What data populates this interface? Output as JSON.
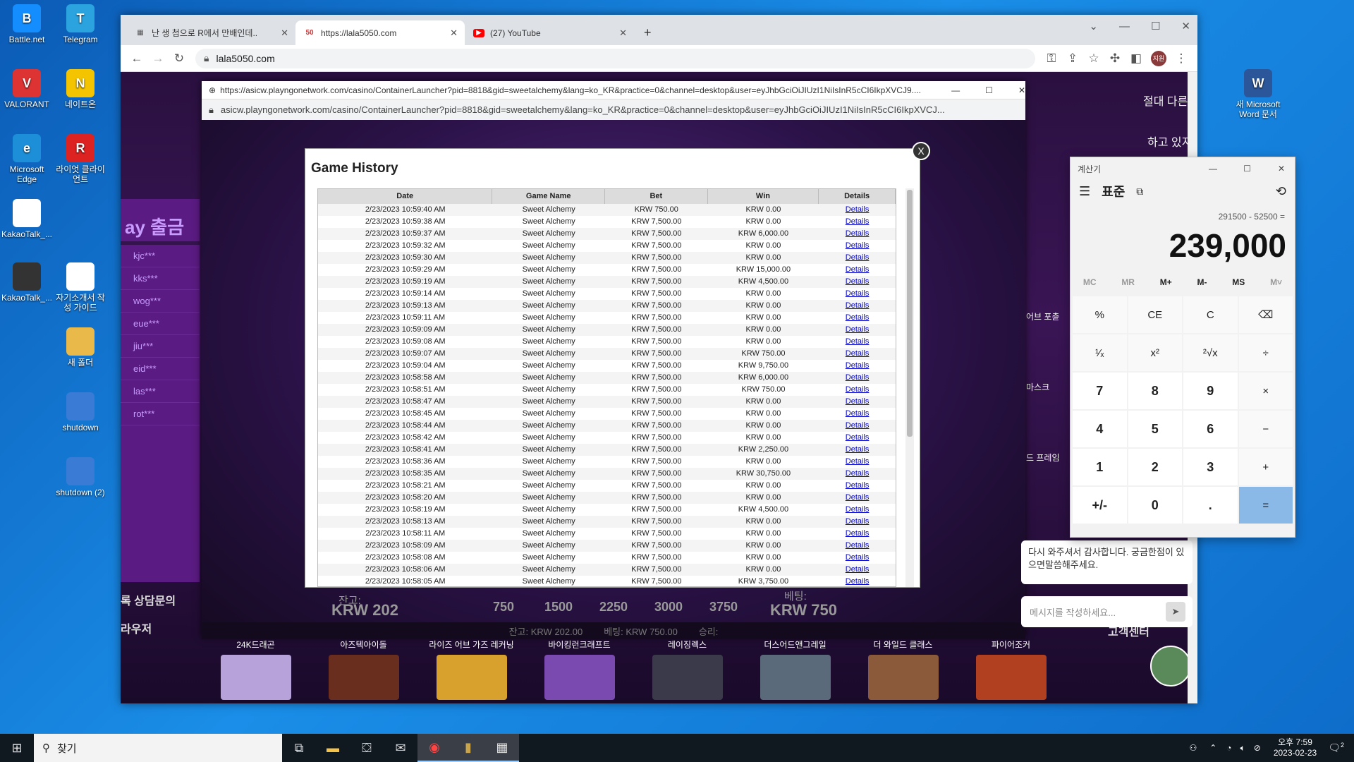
{
  "desktop": {
    "icons": [
      {
        "label": "Battle.net",
        "color": "#148eff",
        "glyph": "B"
      },
      {
        "label": "Telegram",
        "color": "#2aa3df",
        "glyph": "T"
      },
      {
        "label": "VALORANT",
        "color": "#d33",
        "glyph": "V"
      },
      {
        "label": "네이트온",
        "color": "#f5c400",
        "glyph": "N"
      },
      {
        "label": "Microsoft Edge",
        "color": "#1c8fd8",
        "glyph": "e"
      },
      {
        "label": "라이엇 클라이언트",
        "color": "#d22",
        "glyph": "R"
      },
      {
        "label": "KakaoTalk_...",
        "color": "#fff",
        "glyph": ""
      },
      {
        "label": "KakaoTalk_...",
        "color": "#333",
        "glyph": ""
      },
      {
        "label": "자기소개서 작성 가이드",
        "color": "#fff",
        "glyph": ""
      },
      {
        "label": "새 폴더",
        "color": "#e9b94a",
        "glyph": ""
      },
      {
        "label": "shutdown",
        "color": "#3a7bd5",
        "glyph": ""
      },
      {
        "label": "shutdown (2)",
        "color": "#3a7bd5",
        "glyph": ""
      },
      {
        "label": "새 Microsoft Word 문서",
        "color": "#2b579a",
        "glyph": "W"
      }
    ]
  },
  "chrome": {
    "tabs": [
      {
        "title": "난 생 첨으로 R에서 만배인데..",
        "favicon": "▦",
        "favcolor": "#555"
      },
      {
        "title": "https://lala5050.com",
        "favicon": "50",
        "favcolor": "#c33"
      },
      {
        "title": "(27) YouTube",
        "favicon": "▶",
        "favcolor": "#f00"
      }
    ],
    "new_tab": "+",
    "address": "lala5050.com",
    "profile": "지원"
  },
  "popup": {
    "title": "https://asicw.playngonetwork.com/casino/ContainerLauncher?pid=8818&gid=sweetalchemy&lang=ko_KR&practice=0&channel=desktop&user=eyJhbGciOiJIUzI1NiIsInR5cCI6IkpXVCJ9....",
    "address": "asicw.playngonetwork.com/casino/ContainerLauncher?pid=8818&gid=sweetalchemy&lang=ko_KR&practice=0&channel=desktop&user=eyJhbGciOiJIUzI1NiIsInR5cCI6IkpXVCJ..."
  },
  "history": {
    "title": "Game History",
    "close": "X",
    "headers": [
      "Date",
      "Game Name",
      "Bet",
      "Win",
      "Details"
    ],
    "rows": [
      [
        "2/23/2023 10:59:40 AM",
        "Sweet Alchemy",
        "KRW 750.00",
        "KRW 0.00",
        "Details"
      ],
      [
        "2/23/2023 10:59:38 AM",
        "Sweet Alchemy",
        "KRW 7,500.00",
        "KRW 0.00",
        "Details"
      ],
      [
        "2/23/2023 10:59:37 AM",
        "Sweet Alchemy",
        "KRW 7,500.00",
        "KRW 6,000.00",
        "Details"
      ],
      [
        "2/23/2023 10:59:32 AM",
        "Sweet Alchemy",
        "KRW 7,500.00",
        "KRW 0.00",
        "Details"
      ],
      [
        "2/23/2023 10:59:30 AM",
        "Sweet Alchemy",
        "KRW 7,500.00",
        "KRW 0.00",
        "Details"
      ],
      [
        "2/23/2023 10:59:29 AM",
        "Sweet Alchemy",
        "KRW 7,500.00",
        "KRW 15,000.00",
        "Details"
      ],
      [
        "2/23/2023 10:59:19 AM",
        "Sweet Alchemy",
        "KRW 7,500.00",
        "KRW 4,500.00",
        "Details"
      ],
      [
        "2/23/2023 10:59:14 AM",
        "Sweet Alchemy",
        "KRW 7,500.00",
        "KRW 0.00",
        "Details"
      ],
      [
        "2/23/2023 10:59:13 AM",
        "Sweet Alchemy",
        "KRW 7,500.00",
        "KRW 0.00",
        "Details"
      ],
      [
        "2/23/2023 10:59:11 AM",
        "Sweet Alchemy",
        "KRW 7,500.00",
        "KRW 0.00",
        "Details"
      ],
      [
        "2/23/2023 10:59:09 AM",
        "Sweet Alchemy",
        "KRW 7,500.00",
        "KRW 0.00",
        "Details"
      ],
      [
        "2/23/2023 10:59:08 AM",
        "Sweet Alchemy",
        "KRW 7,500.00",
        "KRW 0.00",
        "Details"
      ],
      [
        "2/23/2023 10:59:07 AM",
        "Sweet Alchemy",
        "KRW 7,500.00",
        "KRW 750.00",
        "Details"
      ],
      [
        "2/23/2023 10:59:04 AM",
        "Sweet Alchemy",
        "KRW 7,500.00",
        "KRW 9,750.00",
        "Details"
      ],
      [
        "2/23/2023 10:58:58 AM",
        "Sweet Alchemy",
        "KRW 7,500.00",
        "KRW 6,000.00",
        "Details"
      ],
      [
        "2/23/2023 10:58:51 AM",
        "Sweet Alchemy",
        "KRW 7,500.00",
        "KRW 750.00",
        "Details"
      ],
      [
        "2/23/2023 10:58:47 AM",
        "Sweet Alchemy",
        "KRW 7,500.00",
        "KRW 0.00",
        "Details"
      ],
      [
        "2/23/2023 10:58:45 AM",
        "Sweet Alchemy",
        "KRW 7,500.00",
        "KRW 0.00",
        "Details"
      ],
      [
        "2/23/2023 10:58:44 AM",
        "Sweet Alchemy",
        "KRW 7,500.00",
        "KRW 0.00",
        "Details"
      ],
      [
        "2/23/2023 10:58:42 AM",
        "Sweet Alchemy",
        "KRW 7,500.00",
        "KRW 0.00",
        "Details"
      ],
      [
        "2/23/2023 10:58:41 AM",
        "Sweet Alchemy",
        "KRW 7,500.00",
        "KRW 2,250.00",
        "Details"
      ],
      [
        "2/23/2023 10:58:36 AM",
        "Sweet Alchemy",
        "KRW 7,500.00",
        "KRW 0.00",
        "Details"
      ],
      [
        "2/23/2023 10:58:35 AM",
        "Sweet Alchemy",
        "KRW 7,500.00",
        "KRW 30,750.00",
        "Details"
      ],
      [
        "2/23/2023 10:58:21 AM",
        "Sweet Alchemy",
        "KRW 7,500.00",
        "KRW 0.00",
        "Details"
      ],
      [
        "2/23/2023 10:58:20 AM",
        "Sweet Alchemy",
        "KRW 7,500.00",
        "KRW 0.00",
        "Details"
      ],
      [
        "2/23/2023 10:58:19 AM",
        "Sweet Alchemy",
        "KRW 7,500.00",
        "KRW 4,500.00",
        "Details"
      ],
      [
        "2/23/2023 10:58:13 AM",
        "Sweet Alchemy",
        "KRW 7,500.00",
        "KRW 0.00",
        "Details"
      ],
      [
        "2/23/2023 10:58:11 AM",
        "Sweet Alchemy",
        "KRW 7,500.00",
        "KRW 0.00",
        "Details"
      ],
      [
        "2/23/2023 10:58:09 AM",
        "Sweet Alchemy",
        "KRW 7,500.00",
        "KRW 0.00",
        "Details"
      ],
      [
        "2/23/2023 10:58:08 AM",
        "Sweet Alchemy",
        "KRW 7,500.00",
        "KRW 0.00",
        "Details"
      ],
      [
        "2/23/2023 10:58:06 AM",
        "Sweet Alchemy",
        "KRW 7,500.00",
        "KRW 0.00",
        "Details"
      ],
      [
        "2/23/2023 10:58:05 AM",
        "Sweet Alchemy",
        "KRW 7,500.00",
        "KRW 3,750.00",
        "Details"
      ]
    ]
  },
  "game": {
    "balance_label": "잔고:",
    "balance": "KRW 202",
    "bet_label": "베팅:",
    "bet": "KRW 750",
    "bet_options": [
      "750",
      "1500",
      "2250",
      "3000",
      "3750"
    ],
    "status_balance": "잔고: KRW 202.00",
    "status_bet": "베팅: KRW 750.00",
    "status_win": "승리:"
  },
  "site": {
    "withdraw_title": "ay 출금",
    "users": [
      "kjc***",
      "kks***",
      "wog***",
      "eue***",
      "jiu***",
      "eid***",
      "las***",
      "rot***"
    ],
    "left_bottom1": "록  상담문의",
    "left_bottom2": "라우저",
    "right_games": [
      "어브 포츈",
      "마스크",
      "드 프레임"
    ],
    "right_texts": [
      "절대 다른 사이트 가입을 유도하",
      "하고 있지 않으니, 오공 관련 카톡"
    ],
    "chat_text": "다시 와주셔서 감사합니다. 궁금한점이 있으면말씀해주세요.",
    "msg_placeholder": "메시지를 작성하세요...",
    "support": "고객센터",
    "thumbs": [
      "24K드래곤",
      "아즈텍아이돌",
      "라이즈 어브 가즈 레커닝",
      "바이킹런크래프트",
      "레이징렉스",
      "더스어드앤그레일",
      "더 와일드 클래스",
      "파이어조커"
    ]
  },
  "calculator": {
    "app_title": "계산기",
    "mode": "표준",
    "expression": "291500 - 52500 =",
    "value": "239,000",
    "memory": [
      "MC",
      "MR",
      "M+",
      "M-",
      "MS",
      "M˅"
    ],
    "keys": [
      "%",
      "CE",
      "C",
      "⌫",
      "¹⁄ₓ",
      "x²",
      "²√x",
      "÷",
      "7",
      "8",
      "9",
      "×",
      "4",
      "5",
      "6",
      "−",
      "1",
      "2",
      "3",
      "+",
      "+/-",
      "0",
      ".",
      "="
    ]
  },
  "taskbar": {
    "search": "찾기",
    "time": "오후 7:59",
    "date": "2023-02-23",
    "notif": "2"
  }
}
